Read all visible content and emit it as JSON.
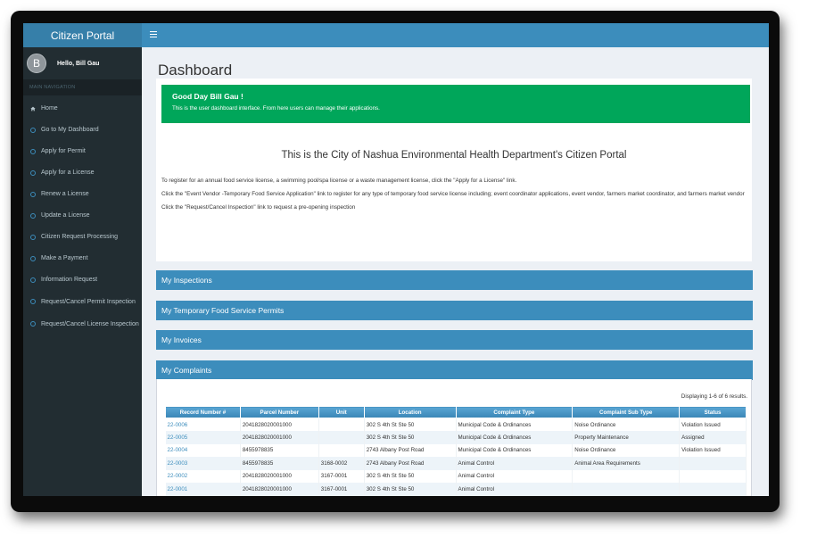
{
  "sidebar": {
    "brand": "Citizen Portal",
    "avatar_initial": "B",
    "user_greeting": "Hello, Bill Gau",
    "nav_header": "MAIN NAVIGATION",
    "items": [
      {
        "label": "Home"
      },
      {
        "label": "Go to My Dashboard"
      },
      {
        "label": "Apply for Permit"
      },
      {
        "label": "Apply for a License"
      },
      {
        "label": "Renew a License"
      },
      {
        "label": "Update a License"
      },
      {
        "label": "Citizen Request Processing"
      },
      {
        "label": "Make a Payment"
      },
      {
        "label": "Information Request"
      },
      {
        "label": "Request/Cancel Permit Inspection"
      },
      {
        "label": "Request/Cancel License Inspection"
      }
    ]
  },
  "page": {
    "title": "Dashboard"
  },
  "callout": {
    "heading": "Good Day Bill Gau !",
    "text": "This is the user dashboard interface. From here users can manage their applications."
  },
  "intro": {
    "title": "This is the City of Nashua Environmental Health Department's Citizen Portal",
    "p1": "To register for an annual food service license, a swimming pool/spa license or a waste management license, click the \"Apply for a License\" link.",
    "p2": "Click the \"Event Vendor -Temporary Food Service Application\" link to register for any type of temporary food service license including; event coordinator applications, event vendor, farmers market coordinator, and farmers market vendor",
    "p3": "Click the \"Request/Cancel Inspection\" link to request a pre-opening inspection"
  },
  "panels": {
    "inspections": "My Inspections",
    "temp_permits": "My Temporary Food Service Permits",
    "invoices": "My Invoices",
    "complaints": "My Complaints"
  },
  "complaints": {
    "results_text": "Displaying 1-6 of 6 results.",
    "columns": [
      "Record Number #",
      "Parcel Number",
      "Unit",
      "Location",
      "Complaint Type",
      "Complaint Sub Type",
      "Status"
    ],
    "rows": [
      [
        "22-0006",
        "2041828020001000",
        "",
        "302 S 4th St Ste 50",
        "Municipal Code & Ordinances",
        "Noise Ordinance",
        "Violation Issued"
      ],
      [
        "22-0005",
        "2041828020001000",
        "",
        "302 S 4th St Ste 50",
        "Municipal Code & Ordinances",
        "Property Maintenance",
        "Assigned"
      ],
      [
        "22-0004",
        "8455978835",
        "",
        "2743 Albany Post Road",
        "Municipal Code & Ordinances",
        "Noise Ordinance",
        "Violation Issued"
      ],
      [
        "22-0003",
        "8455978835",
        "3168-0002",
        "2743 Albany Post Road",
        "Animal Control",
        "Animal Area Requirements",
        ""
      ],
      [
        "22-0002",
        "2041828020001000",
        "3167-0001",
        "302 S 4th St Ste 50",
        "Animal Control",
        "",
        ""
      ],
      [
        "22-0001",
        "2041828020001000",
        "3167-0001",
        "302 S 4th St Ste 50",
        "Animal Control",
        "",
        ""
      ]
    ]
  },
  "colors": {
    "sidebar": "#222d32",
    "brand": "#367fa9",
    "accent": "#3c8dbc",
    "success": "#00a65a"
  }
}
